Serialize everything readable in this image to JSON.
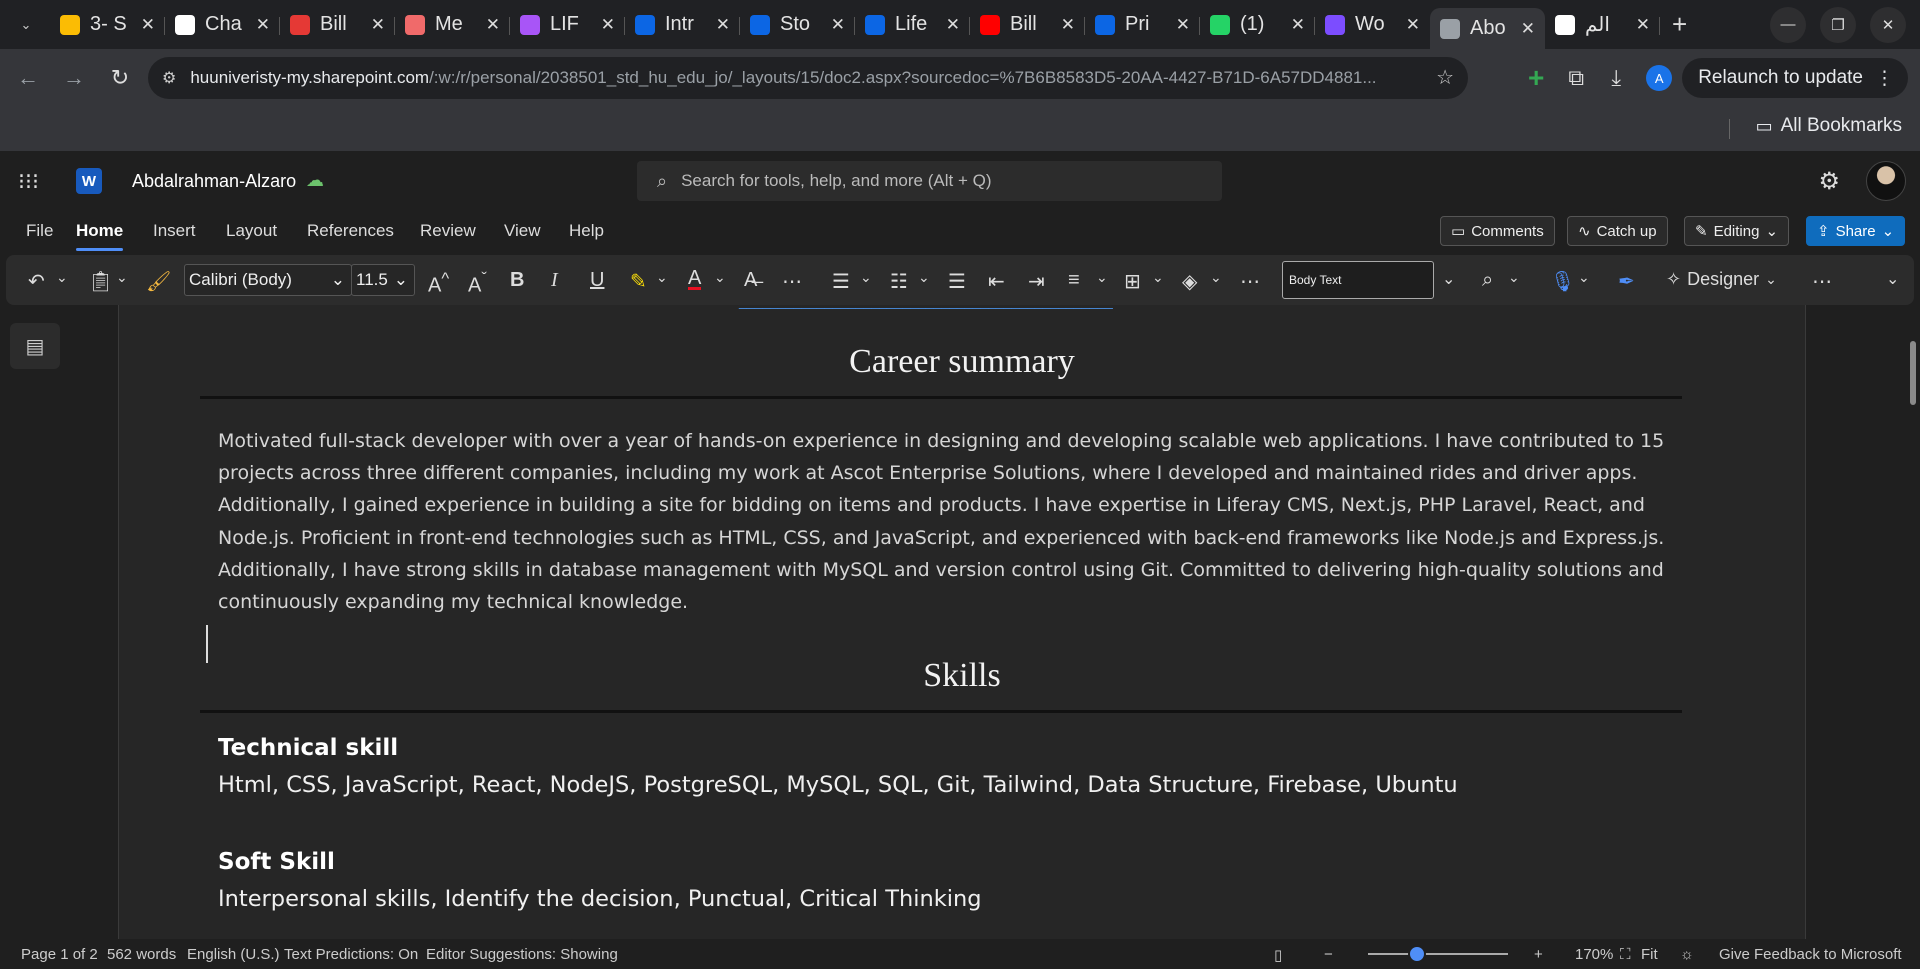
{
  "browser": {
    "tabs": [
      {
        "title": "3- S",
        "icon": "chrome-tab-favicon",
        "color": "#fbbc04"
      },
      {
        "title": "Cha",
        "icon": "chatgpt-icon",
        "color": "#ffffff"
      },
      {
        "title": "Bill",
        "icon": "billing-favicon",
        "color": "#e53935"
      },
      {
        "title": "Me",
        "icon": "asana-icon",
        "color": "#f06a6a"
      },
      {
        "title": "LIF",
        "icon": "lif-icon",
        "color": "#a855f7"
      },
      {
        "title": "Intr",
        "icon": "jira-grid-icon",
        "color": "#0c66e4"
      },
      {
        "title": "Sto",
        "icon": "jira-grid-icon",
        "color": "#0c66e4"
      },
      {
        "title": "Life",
        "icon": "jira-grid-icon",
        "color": "#0c66e4"
      },
      {
        "title": "Bill",
        "icon": "youtube-icon",
        "color": "#ff0000"
      },
      {
        "title": "Pri",
        "icon": "jira-grid-icon",
        "color": "#0c66e4"
      },
      {
        "title": "(1)",
        "icon": "whatsapp-icon",
        "color": "#25d366"
      },
      {
        "title": "Wo",
        "icon": "copilot-icon",
        "color": "#7c4dff"
      },
      {
        "title": "Abo",
        "icon": "globe-icon",
        "color": "#9aa0a6"
      },
      {
        "title": "الم",
        "icon": "google-icon",
        "color": "#ffffff"
      }
    ],
    "url_host": "huuniveristy-my.sharepoint.com",
    "url_path": "/:w:/r/personal/2038501_std_hu_edu_jo/_layouts/15/doc2.aspx?sourcedoc=%7B6B8583D5-20AA-4427-B71D-6A57DD4881...",
    "profile_initial": "A",
    "relaunch_label": "Relaunch to update",
    "bookmarks_label": "All Bookmarks"
  },
  "word": {
    "doc_name": "Abdalrahman-Alzaro",
    "search_placeholder": "Search for tools, help, and more (Alt + Q)",
    "menu": [
      "File",
      "Home",
      "Insert",
      "Layout",
      "References",
      "Review",
      "View",
      "Help"
    ],
    "active_menu": "Home",
    "comments_label": "Comments",
    "catchup_label": "Catch up",
    "editing_label": "Editing",
    "share_label": "Share",
    "font_name": "Calibri (Body)",
    "font_size": "11.5",
    "style_name": "Body Text",
    "designer_label": "Designer"
  },
  "document": {
    "career_heading": "Career summary",
    "summary_text": "Motivated full-stack developer with over a year of hands-on experience in designing and developing scalable web applications. I have contributed to 15 projects across three different companies, including my work at Ascot Enterprise Solutions, where I developed and maintained rides and driver apps. Additionally, I gained experience in building a site for bidding on items and products. I have expertise in Liferay CMS, Next.js, PHP Laravel, React, and Node.js. Proficient in front-end technologies such as HTML, CSS, and JavaScript, and experienced with back-end frameworks like Node.js and Express.js. Additionally, I have strong skills in database management with MySQL and version control using Git. Committed to delivering high-quality solutions and continuously expanding my technical knowledge.",
    "skills_heading": "Skills",
    "technical_title": "Technical skill",
    "technical_list": "Html, CSS, JavaScript, React, NodeJS, PostgreSQL, MySQL, SQL, Git, Tailwind, Data Structure, Firebase, Ubuntu",
    "soft_title": "Soft Skill",
    "soft_list": "Interpersonal skills, Identify the decision, Punctual, Critical Thinking"
  },
  "status": {
    "page": "Page 1 of 2",
    "words": "562 words",
    "language": "English (U.S.)",
    "predictions": "Text Predictions: On",
    "editor": "Editor Suggestions: Showing",
    "zoom": "170%",
    "zoom_fraction": 0.35,
    "fit": "Fit",
    "feedback": "Give Feedback to Microsoft"
  }
}
